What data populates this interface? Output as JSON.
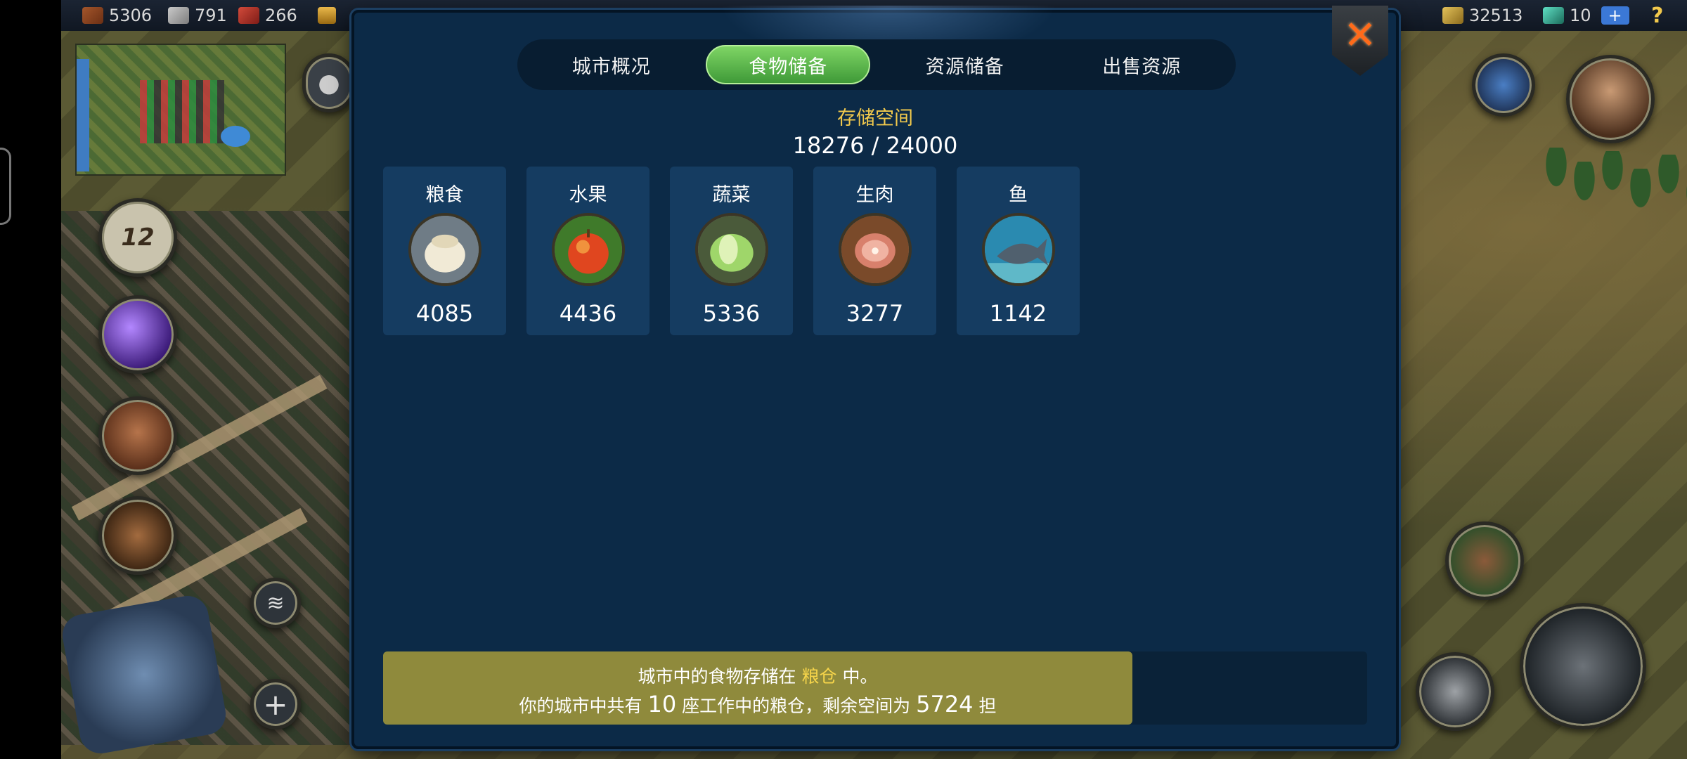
{
  "top_bar": {
    "resources_left": [
      {
        "icon": "wood-icon",
        "value": "5306"
      },
      {
        "icon": "stone-icon",
        "value": "791"
      },
      {
        "icon": "brick-icon",
        "value": "266"
      }
    ],
    "resources_right": [
      {
        "icon": "gold-ingot-icon",
        "value": "32513"
      },
      {
        "icon": "jade-icon",
        "value": "10"
      }
    ],
    "add_label": "+",
    "help_label": "?"
  },
  "side_buttons": {
    "calendar_day": "12"
  },
  "modal": {
    "tabs": [
      {
        "label": "城市概况",
        "active": false
      },
      {
        "label": "食物储备",
        "active": true
      },
      {
        "label": "资源储备",
        "active": false
      },
      {
        "label": "出售资源",
        "active": false
      }
    ],
    "storage_title": "存储空间",
    "storage_value": "18276 / 24000",
    "foods": [
      {
        "name": "粮食",
        "amount": "4085",
        "icon": "grain-sack-icon"
      },
      {
        "name": "水果",
        "amount": "4436",
        "icon": "apple-icon"
      },
      {
        "name": "蔬菜",
        "amount": "5336",
        "icon": "cabbage-icon"
      },
      {
        "name": "生肉",
        "amount": "3277",
        "icon": "meat-icon"
      },
      {
        "name": "鱼",
        "amount": "1142",
        "icon": "fish-icon"
      }
    ],
    "info": {
      "line1_pre": "城市中的食物存储在",
      "line1_hl": "粮仓",
      "line1_post": "中。",
      "line2_pre": "你的城市中共有",
      "line2_count": "10",
      "line2_mid": "座工作中的粮仓，剩余空间为",
      "line2_space": "5724",
      "line2_unit": "担"
    }
  },
  "colors": {
    "modal_bg": "#0c2a47",
    "tab_active": "#4fae42",
    "gold_text": "#f2c94c",
    "info_highlight": "#8f8a3c"
  }
}
